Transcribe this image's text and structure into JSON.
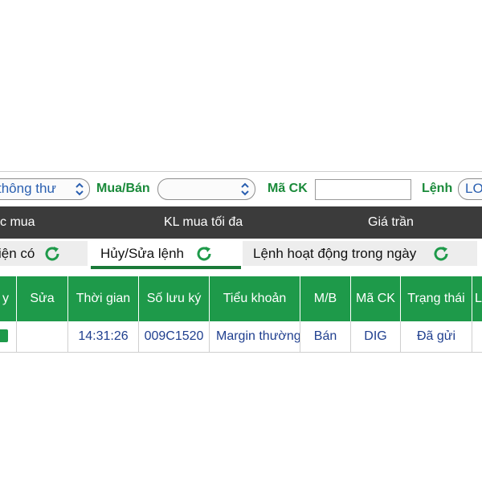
{
  "filters": {
    "type_select_value": "thông thư",
    "buysell_label": "Mua/Bán",
    "buysell_value": "",
    "stock_code_label": "Mã CK",
    "stock_code_value": "",
    "order_label": "Lệnh",
    "order_select_value": "LO"
  },
  "info_bar": {
    "col1": "c mua",
    "col2": "KL mua tối đa",
    "col3": "Giá trần"
  },
  "tabs": [
    {
      "label": "iện có",
      "active": false
    },
    {
      "label": "Hủy/Sửa lệnh",
      "active": true
    },
    {
      "label": "Lệnh hoạt động trong ngày",
      "active": false
    }
  ],
  "table": {
    "headers": {
      "select": "y",
      "edit": "Sửa",
      "time": "Thời gian",
      "depository": "Số lưu ký",
      "sub_account": "Tiểu khoản",
      "side": "M/B",
      "symbol": "Mã CK",
      "status": "Trạng thái",
      "more": "L"
    },
    "rows": [
      {
        "edit": "",
        "time": "14:31:26",
        "depository": "009C1520",
        "sub_account": "Margin thường",
        "side": "Bán",
        "symbol": "DIG",
        "status": "Đã gửi",
        "more": ""
      }
    ]
  },
  "colors": {
    "accent_green": "#1e9a4a",
    "label_green": "#1a8a3a",
    "dark_bar": "#3b3b3b",
    "link_blue": "#2a5fb0",
    "cell_text": "#1f3f8f"
  },
  "icons": {
    "select_chevron": "chevron-up-down-icon",
    "tab_refresh": "refresh-icon"
  }
}
